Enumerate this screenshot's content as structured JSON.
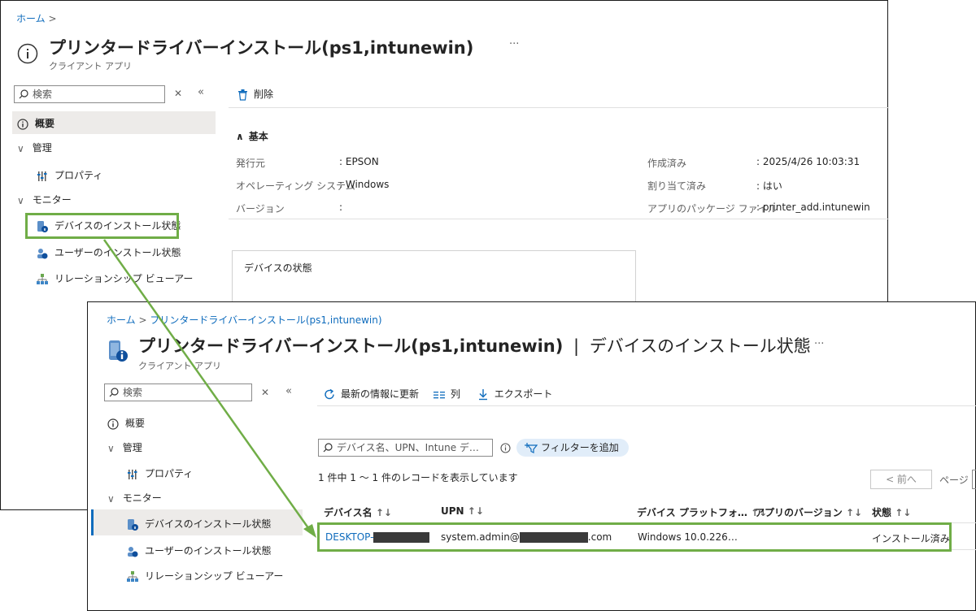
{
  "back": {
    "breadcrumb": [
      "ホーム"
    ],
    "title": "プリンタードライバーインストール(ps1,intunewin)",
    "subtitle": "クライアント アプリ",
    "more": "···",
    "search_placeholder": "検索",
    "nav": {
      "overview": "概要",
      "manage": "管理",
      "properties": "プロパティ",
      "monitor": "モニター",
      "device_install": "デバイスのインストール状態",
      "user_install": "ユーザーのインストール状態",
      "relationship": "リレーションシップ ビューアー"
    },
    "toolbar_delete": "削除",
    "essentials_header": "基本",
    "essentials_left": [
      {
        "label": "発行元",
        "value": "EPSON"
      },
      {
        "label": "オペレーティング システム",
        "value": "Windows"
      },
      {
        "label": "バージョン",
        "value": ""
      }
    ],
    "essentials_right": [
      {
        "label": "作成済み",
        "value": "2025/4/26 10:03:31"
      },
      {
        "label": "割り当て済み",
        "value": "はい"
      },
      {
        "label": "アプリのパッケージ ファイル",
        "value": "printer_add.intunewin"
      }
    ],
    "device_status_card": "デバイスの状態"
  },
  "front": {
    "breadcrumb": [
      "ホーム",
      "プリンタードライバーインストール(ps1,intunewin)"
    ],
    "title": "プリンタードライバーインストール(ps1,intunewin)",
    "title_divider": "|",
    "title_suffix": "デバイスのインストール状態",
    "subtitle": "クライアント アプリ",
    "more": "···",
    "search_placeholder": "検索",
    "nav": {
      "overview": "概要",
      "manage": "管理",
      "properties": "プロパティ",
      "monitor": "モニター",
      "device_install": "デバイスのインストール状態",
      "user_install": "ユーザーのインストール状態",
      "relationship": "リレーションシップ ビューアー"
    },
    "toolbar": {
      "refresh": "最新の情報に更新",
      "columns": "列",
      "export": "エクスポート"
    },
    "filter_placeholder": "デバイス名、UPN、Intune デ…",
    "add_filter": "フィルターを追加",
    "record_count": "1 件中 1 ～ 1 件のレコードを表示しています",
    "prev_button": "< 前へ",
    "page_label": "ページ",
    "columns": [
      "デバイス名",
      "UPN",
      "デバイス プラットフォ…",
      "アプリのバージョン",
      "状態"
    ],
    "row": {
      "device_prefix": "DESKTOP-",
      "upn_prefix": "system.admin@",
      "upn_suffix": ".com",
      "platform": "Windows 10.0.226…",
      "app_version": "",
      "status": "インストール済み"
    }
  },
  "colors": {
    "highlight": "#70ad47",
    "link": "#0f6cbd",
    "selected_nav": "#edebe9"
  }
}
